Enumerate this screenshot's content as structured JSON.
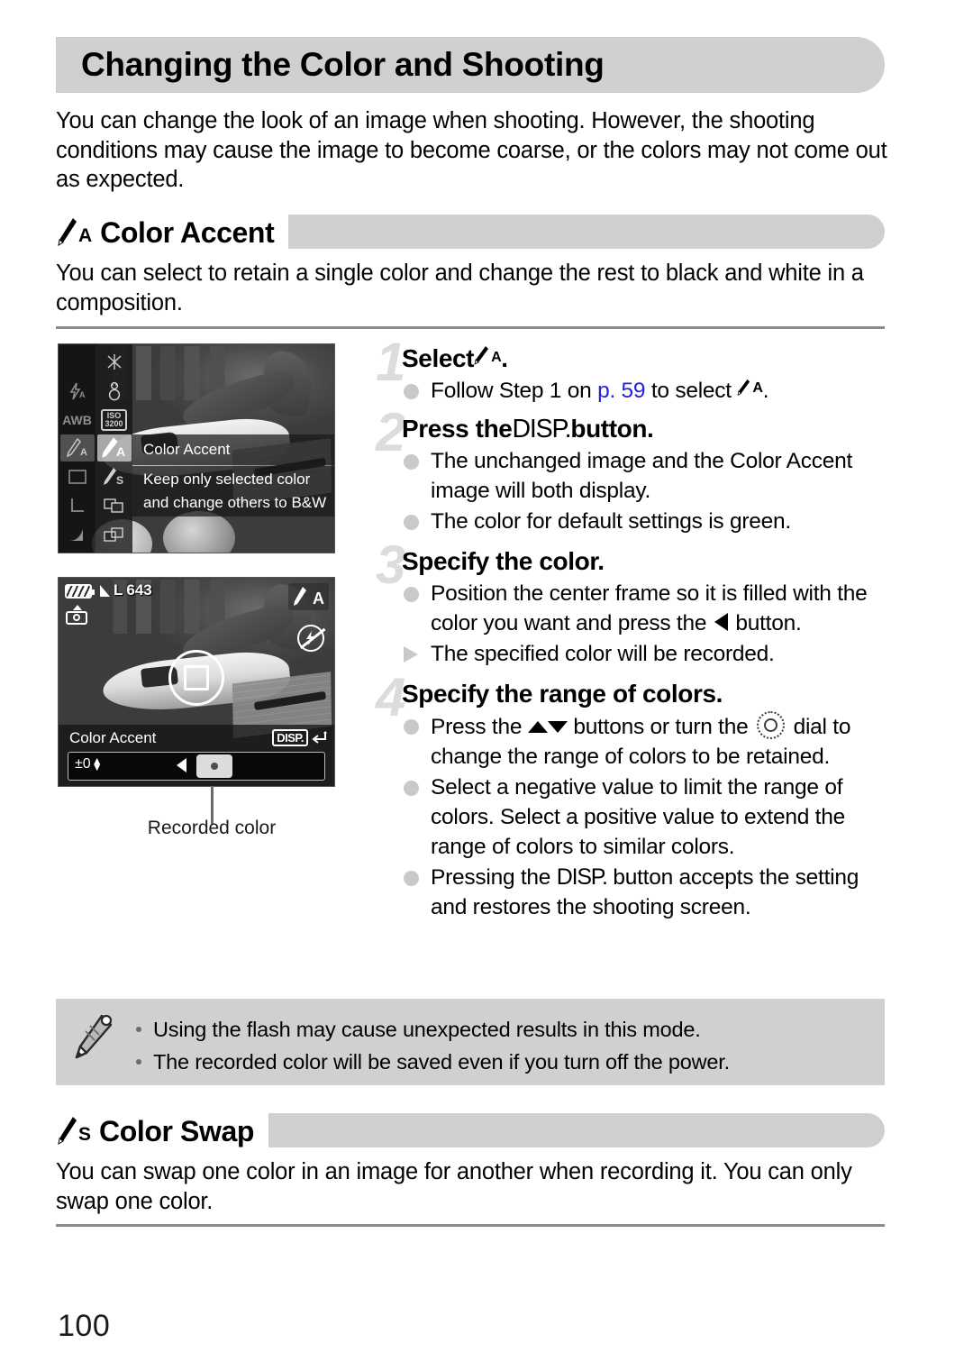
{
  "page": {
    "title": "Changing the Color and Shooting",
    "number": "100",
    "intro": "You can change the look of an image when shooting. However, the shooting conditions may cause the image to become coarse, or the colors may not come out as expected."
  },
  "sections": [
    {
      "icon": "brush-a-icon",
      "icon_sub": "A",
      "title": "Color Accent",
      "description": "You can select to retain a single color and change the rest to black and white in a composition."
    },
    {
      "icon": "brush-s-icon",
      "icon_sub": "S",
      "title": "Color Swap",
      "description": "You can swap one color in an image for another when recording it. You can only swap one color."
    }
  ],
  "steps": [
    {
      "num": "1",
      "title_before": "Select ",
      "title_icon_sub": "A",
      "title_after": ".",
      "bullets": [
        {
          "type": "dot",
          "parts": [
            {
              "t": "text",
              "v": "Follow Step 1 on "
            },
            {
              "t": "link",
              "v": "p. 59"
            },
            {
              "t": "text",
              "v": " to select "
            },
            {
              "t": "brush",
              "v": "A"
            },
            {
              "t": "text",
              "v": "."
            }
          ]
        }
      ]
    },
    {
      "num": "2",
      "title_before": "Press the ",
      "title_disp": "DISP.",
      "title_after": " button.",
      "bullets": [
        {
          "type": "dot",
          "parts": [
            {
              "t": "text",
              "v": "The unchanged image and the Color Accent image will both display."
            }
          ]
        },
        {
          "type": "dot",
          "parts": [
            {
              "t": "text",
              "v": "The color for default settings is green."
            }
          ]
        }
      ]
    },
    {
      "num": "3",
      "title_before": "Specify the color.",
      "bullets": [
        {
          "type": "dot",
          "parts": [
            {
              "t": "text",
              "v": "Position the center frame so it is filled with the color you want and press the "
            },
            {
              "t": "tri-left",
              "v": ""
            },
            {
              "t": "text",
              "v": " button."
            }
          ]
        },
        {
          "type": "arrow",
          "parts": [
            {
              "t": "text",
              "v": "The specified color will be recorded."
            }
          ]
        }
      ]
    },
    {
      "num": "4",
      "title_before": "Specify the range of colors.",
      "bullets": [
        {
          "type": "dot",
          "parts": [
            {
              "t": "text",
              "v": "Press the "
            },
            {
              "t": "tri-up",
              "v": ""
            },
            {
              "t": "tri-dn",
              "v": ""
            },
            {
              "t": "text",
              "v": " buttons or turn the "
            },
            {
              "t": "dial",
              "v": ""
            },
            {
              "t": "text",
              "v": " dial to change the range of colors to be retained."
            }
          ]
        },
        {
          "type": "dot",
          "parts": [
            {
              "t": "text",
              "v": "Select a negative value to limit the range of colors. Select a positive value to extend the range of colors to similar colors."
            }
          ]
        },
        {
          "type": "dot",
          "parts": [
            {
              "t": "text",
              "v": "Pressing the "
            },
            {
              "t": "disp",
              "v": "DISP."
            },
            {
              "t": "text",
              "v": " button accepts the setting and restores the shooting screen."
            }
          ]
        }
      ]
    }
  ],
  "tips": [
    "Using the flash may cause unexpected results in this mode.",
    "The recorded color will be saved even if you turn off the power."
  ],
  "screens": {
    "menu": {
      "column1_items": [
        "flash-a-icon",
        "AWB",
        "brush-a-icon",
        "aspect-icon",
        "size-l-icon",
        "gradient-icon"
      ],
      "column2_items": [
        "fireworks-icon",
        "snow-icon",
        "ISO 3200",
        "brush-a-icon",
        "brush-s-icon",
        "stitch-left-icon",
        "stitch-right-icon"
      ],
      "iso_top": "ISO",
      "iso_bottom": "3200",
      "awb_label": "AWB",
      "selected_label": "Color Accent",
      "description_line1": "Keep only selected color",
      "description_line2": "and change others to B&W"
    },
    "shooting": {
      "quality": "L",
      "shots_remaining": "643",
      "mode_icon_sub": "A",
      "title": "Color Accent",
      "disp_label": "DISP.",
      "slider_value": "±0",
      "callout": "Recorded color"
    }
  },
  "colors": {
    "header_bar": "#d0d0d0",
    "section_bar": "#cfcfcf",
    "link": "#2222e0",
    "step_number": "#dcdcdc",
    "bullet_dot": "#c9c9c9",
    "tip_box": "#d0d0d0",
    "rule": "#8a8a8a"
  }
}
